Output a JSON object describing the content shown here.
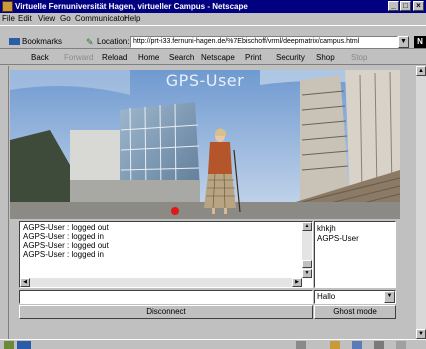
{
  "window": {
    "title": "Virtuelle Fernuniversität Hagen, virtueller Campus - Netscape",
    "controls": [
      "_",
      "□",
      "×"
    ]
  },
  "menu": [
    "File",
    "Edit",
    "View",
    "Go",
    "Communicator",
    "Help"
  ],
  "location_bar": {
    "bookmarks_label": "Bookmarks",
    "location_label": "Location:",
    "url": "http://prt-i33.fernuni-hagen.de/%7Ebischoff/vrml/deepmatrix/campus.html"
  },
  "navigation": {
    "buttons": [
      {
        "label": "Back",
        "enabled": true
      },
      {
        "label": "Forward",
        "enabled": false
      },
      {
        "label": "Reload",
        "enabled": true
      },
      {
        "label": "Home",
        "enabled": true
      },
      {
        "label": "Search",
        "enabled": true
      },
      {
        "label": "Netscape",
        "enabled": true
      },
      {
        "label": "Print",
        "enabled": true
      },
      {
        "label": "Security",
        "enabled": true
      },
      {
        "label": "Shop",
        "enabled": true
      },
      {
        "label": "Stop",
        "enabled": false
      }
    ]
  },
  "scene": {
    "title": "GPS-User"
  },
  "chat": {
    "log": [
      "AGPS-User : logged out",
      "AGPS-User : logged in",
      "AGPS-User : logged out",
      "AGPS-User : logged in"
    ],
    "input_value": ""
  },
  "users": [
    "khkjh",
    "AGPS-User"
  ],
  "greeting": {
    "selected": "Hallo"
  },
  "actions": {
    "disconnect_label": "Disconnect",
    "ghost_label": "Ghost mode"
  },
  "colors": {
    "titlebar": "#000080",
    "window_face": "#c0c0c0",
    "sky": "#8aaed8"
  }
}
